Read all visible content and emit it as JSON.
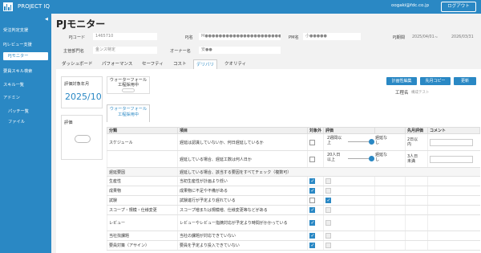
{
  "header": {
    "brand": "PROJECT IQ",
    "user_email": "oogaki@fdc.co.jp",
    "logout_label": "ログアウト"
  },
  "sidebar": {
    "collapse": "◀",
    "items": [
      {
        "label": "受注判定支援"
      },
      {
        "label": "PJレビュー支援"
      },
      {
        "label": "PJモニター"
      },
      {
        "label": "要員スキル検索"
      },
      {
        "label": "スキル一覧"
      },
      {
        "label": "アドミン"
      },
      {
        "label": "パッチー覧"
      },
      {
        "label": "ファイル"
      }
    ]
  },
  "page": {
    "title": "PJモニター",
    "fields": {
      "pj_code_label": "PJコード",
      "pj_code_value": "1465710",
      "pj_name_label": "PJ名",
      "pj_name_value": "M●●●●●●●●●●●●●●●●●●●●●●",
      "pm_label": "PM名",
      "pm_value": "小●●●●●",
      "period_label": "PJ期間",
      "period_start": "2025/04/01",
      "period_sep": "~",
      "period_end": "2026/03/31",
      "dept_label": "主管部門名",
      "dept_value": "金ンス特定",
      "owner_label": "オーナー名",
      "owner_value": "安●●"
    }
  },
  "tabs": [
    {
      "label": "ダッシュボード"
    },
    {
      "label": "パフォーマンス"
    },
    {
      "label": "セーフティ"
    },
    {
      "label": "コスト"
    },
    {
      "label": "デリバリ"
    },
    {
      "label": "クオリティ"
    }
  ],
  "delivery": {
    "eval_month_label": "評価対象年月",
    "eval_month_value": "2025/10",
    "eval_label": "評価",
    "wf1_label": "ウォーターフォール\n工程採用中",
    "wf2_label": "ウォーターフォール\n工程採用中",
    "btn_edit_history": "計画性編集",
    "btn_copy_prev": "先月コピー",
    "btn_update": "更新",
    "process_name_label": "工程名",
    "process_name_value": "構成テスト"
  },
  "table": {
    "headers": [
      "分類",
      "項目",
      "対象外",
      "評価",
      "",
      "先月評価",
      "コメント"
    ],
    "rows": [
      {
        "category": "スケジュール",
        "item": "遅延は認識していないか、何日遅延しているか",
        "slider_left": "2週間以\n上",
        "slider_right": "遅延な\nし",
        "slider_extra": "2日以\n内",
        "type": "slider"
      },
      {
        "category": "",
        "item": "遅延している場合、遅延工数は何人日か",
        "slider_left": "20人日\n以上",
        "slider_right": "遅延な\nし",
        "slider_extra": "3人日\n未満",
        "type": "slider"
      },
      {
        "category": "遅延要因",
        "item": "遅延している場合、該当する要因をすべてチェック（複数可）",
        "type": "group"
      },
      {
        "category": "生産性",
        "item": "当初生産性が計画より低い",
        "checked": true,
        "type": "check"
      },
      {
        "category": "成果物",
        "item": "成果物に不足や不備がある",
        "checked": true,
        "type": "check"
      },
      {
        "category": "試験",
        "item": "試験進行が予定より遅れている",
        "checked": false,
        "eval_checked": true,
        "type": "check"
      },
      {
        "category": "スコープ・規模・仕様変更",
        "item": "スコープ増または規模増、仕様変更等などがある",
        "checked": true,
        "type": "check"
      },
      {
        "category": "レビュー",
        "item": "レビューやレビュー指摘対応が予定より時間がかかっている",
        "checked": true,
        "type": "check2"
      },
      {
        "category": "当社找課題",
        "item": "当社の課題が対応できていない",
        "checked": true,
        "type": "check"
      },
      {
        "category": "要員対策（アサイン）",
        "item": "要員を予定より投入できていない",
        "checked": true,
        "type": "check"
      }
    ]
  }
}
